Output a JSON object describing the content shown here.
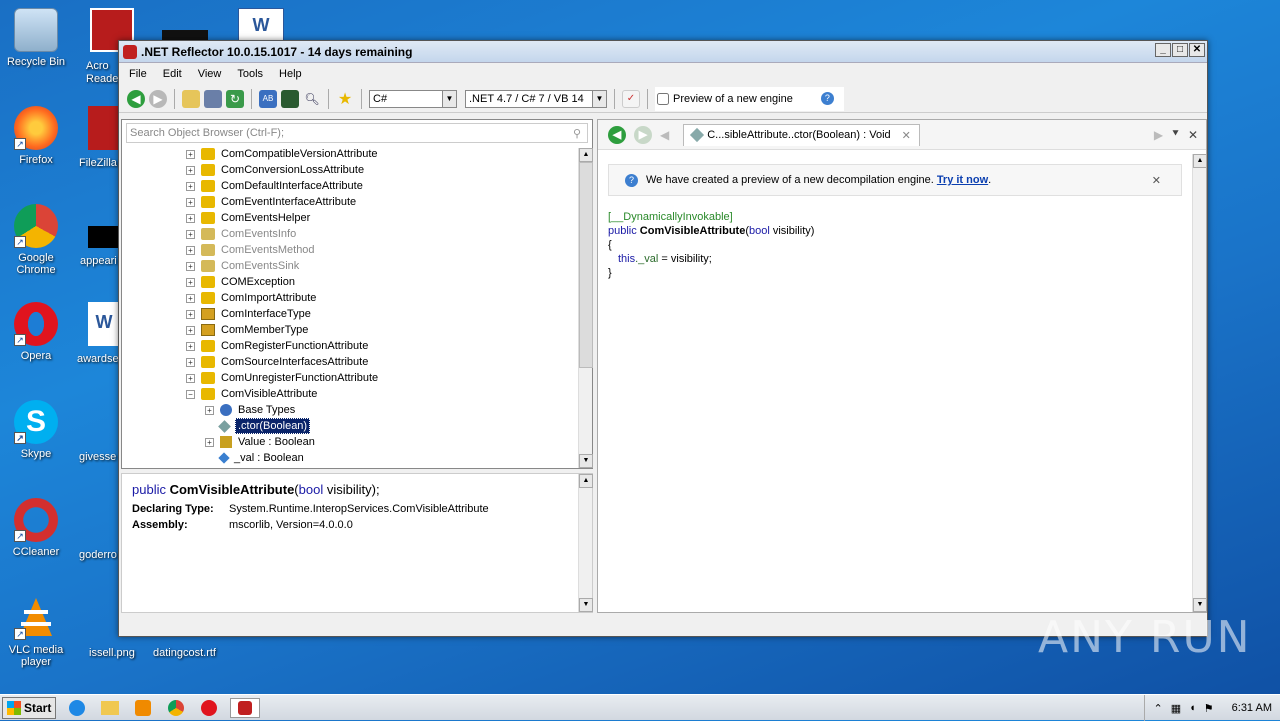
{
  "desktop": {
    "icons": [
      {
        "label": "Recycle Bin",
        "icon": "recycle-bin-icon"
      },
      {
        "label": "Firefox",
        "icon": "firefox-icon"
      },
      {
        "label": "Google Chrome",
        "icon": "chrome-icon"
      },
      {
        "label": "Opera",
        "icon": "opera-icon"
      },
      {
        "label": "Skype",
        "icon": "skype-icon"
      },
      {
        "label": "CCleaner",
        "icon": "ccleaner-icon"
      },
      {
        "label": "VLC media player",
        "icon": "vlc-icon"
      }
    ],
    "partial_labels": [
      "Acro Reade",
      "FileZilla",
      "appeari",
      "awardse",
      "givesse",
      "goderro",
      "issell.png",
      "datingcost.rtf"
    ]
  },
  "window": {
    "title": ".NET Reflector 10.0.15.1017 - 14 days remaining",
    "menu": [
      "File",
      "Edit",
      "View",
      "Tools",
      "Help"
    ],
    "language_combo": "C#",
    "framework_combo": ".NET 4.7 / C# 7 / VB 14",
    "preview_checkbox_label": "Preview of a new engine",
    "search_placeholder": "Search Object Browser (Ctrl-F);"
  },
  "tree": {
    "items": [
      {
        "label": "ComCompatibleVersionAttribute",
        "icon": "class-attribute-icon",
        "gray": false
      },
      {
        "label": "ComConversionLossAttribute",
        "icon": "class-attribute-icon",
        "gray": false
      },
      {
        "label": "ComDefaultInterfaceAttribute",
        "icon": "class-attribute-icon",
        "gray": false
      },
      {
        "label": "ComEventInterfaceAttribute",
        "icon": "class-attribute-icon",
        "gray": false
      },
      {
        "label": "ComEventsHelper",
        "icon": "class-attribute-icon",
        "gray": false
      },
      {
        "label": "ComEventsInfo",
        "icon": "class-internal-icon",
        "gray": true
      },
      {
        "label": "ComEventsMethod",
        "icon": "class-internal-icon",
        "gray": true
      },
      {
        "label": "ComEventsSink",
        "icon": "class-internal-icon",
        "gray": true
      },
      {
        "label": "COMException",
        "icon": "class-attribute-icon",
        "gray": false
      },
      {
        "label": "ComImportAttribute",
        "icon": "class-attribute-icon",
        "gray": false
      },
      {
        "label": "ComInterfaceType",
        "icon": "enum-icon",
        "gray": false
      },
      {
        "label": "ComMemberType",
        "icon": "enum-icon",
        "gray": false
      },
      {
        "label": "ComRegisterFunctionAttribute",
        "icon": "class-attribute-icon",
        "gray": false
      },
      {
        "label": "ComSourceInterfacesAttribute",
        "icon": "class-attribute-icon",
        "gray": false
      },
      {
        "label": "ComUnregisterFunctionAttribute",
        "icon": "class-attribute-icon",
        "gray": false
      },
      {
        "label": "ComVisibleAttribute",
        "icon": "class-attribute-icon",
        "gray": false
      }
    ],
    "children": [
      {
        "label": "Base Types",
        "icon": "base-types-icon"
      },
      {
        "label": ".ctor(Boolean)",
        "icon": "method-icon"
      },
      {
        "label": "Value : Boolean",
        "icon": "property-icon"
      },
      {
        "label": "_val : Boolean",
        "icon": "field-icon"
      }
    ]
  },
  "info": {
    "sig_prefix": "public ",
    "sig_name": "ComVisibleAttribute",
    "sig_open": "(",
    "sig_type": "bool",
    "sig_rest": " visibility);",
    "declaring_label": "Declaring Type:",
    "declaring_value": "System.Runtime.InteropServices.ComVisibleAttribute",
    "assembly_label": "Assembly:",
    "assembly_value": "mscorlib, Version=4.0.0.0"
  },
  "right": {
    "tab_label": "C...sibleAttribute..ctor(Boolean) : Void",
    "banner_text": "We have created a preview of a new decompilation engine. ",
    "banner_link": "Try it now",
    "banner_end": ".",
    "code": {
      "attr": "[__DynamicallyInvokable]",
      "l2_kw": "public ",
      "l2_name": "ComVisibleAttribute",
      "l2_open": "(",
      "l2_type": "bool",
      "l2_rest": " visibility)",
      "l3": "{",
      "l4_this": "this",
      "l4_field": "._val",
      "l4_rest": " = visibility;",
      "l5": "}"
    }
  },
  "taskbar": {
    "start": "Start",
    "time": "6:31 AM"
  },
  "watermark": "ANY RUN"
}
